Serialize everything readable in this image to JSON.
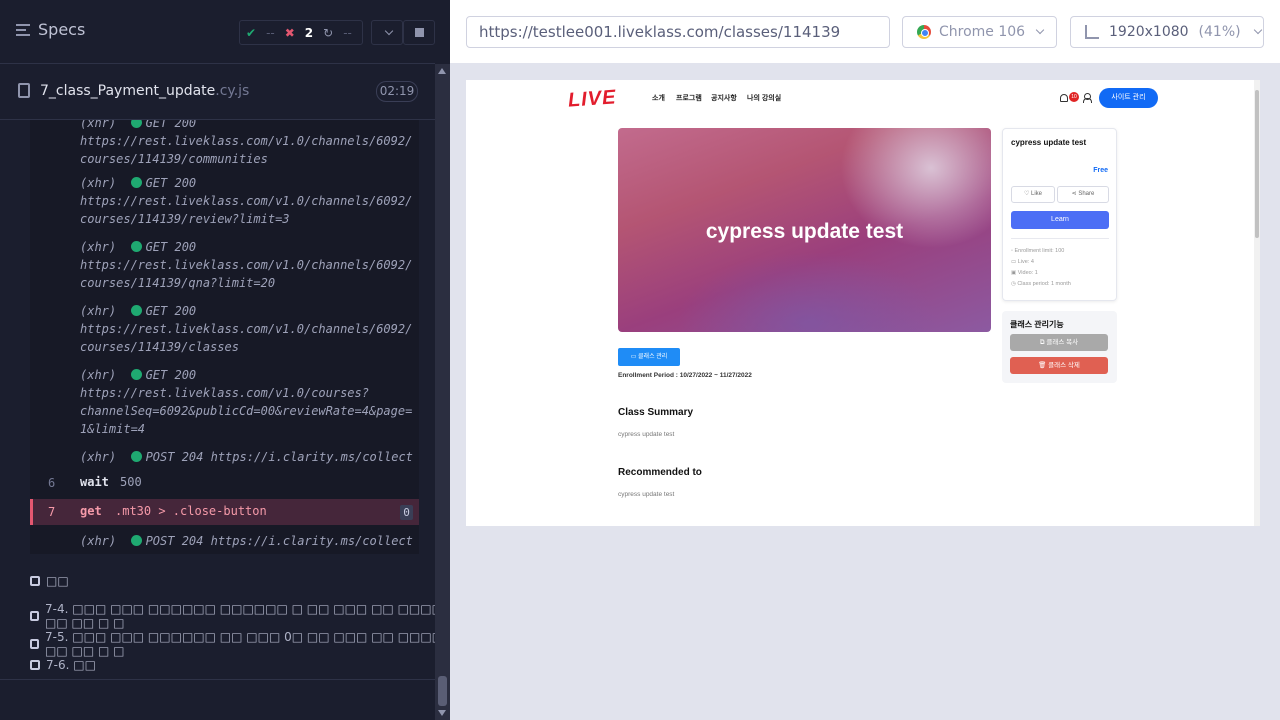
{
  "reporter": {
    "title": "Specs",
    "stats": {
      "passed": "--",
      "failed": "2",
      "pending": "--"
    },
    "spec_file": {
      "name": "7_class_Payment_update",
      "ext": ".cy.js",
      "duration": "02:19"
    },
    "log": [
      {
        "prefix": "(xhr)",
        "method": "GET 200",
        "lines": [
          "https://rest.liveklass.com/v1.0/channels/6092/",
          "courses/114139/communities"
        ]
      },
      {
        "prefix": "(xhr)",
        "method": "GET 200",
        "lines": [
          "https://rest.liveklass.com/v1.0/channels/6092/",
          "courses/114139/review?limit=3"
        ]
      },
      {
        "prefix": "(xhr)",
        "method": "GET 200",
        "lines": [
          "https://rest.liveklass.com/v1.0/channels/6092/",
          "courses/114139/qna?limit=20"
        ]
      },
      {
        "prefix": "(xhr)",
        "method": "GET 200",
        "lines": [
          "https://rest.liveklass.com/v1.0/channels/6092/",
          "courses/114139/classes"
        ]
      },
      {
        "prefix": "(xhr)",
        "method": "GET 200",
        "lines": [
          "https://rest.liveklass.com/v1.0/courses?",
          "channelSeq=6092&publicCd=00&reviewRate=4&page=",
          "1&limit=4"
        ]
      },
      {
        "prefix": "(xhr)",
        "method": "POST 204 https://i.clarity.ms/collect",
        "lines": []
      }
    ],
    "commands": [
      {
        "num": "6",
        "name": "wait",
        "arg": "500"
      },
      {
        "num": "7",
        "name": "get",
        "arg": ".mt30 > .close-button",
        "badge": "0"
      }
    ],
    "last_xhr": {
      "prefix": "(xhr)",
      "method": "POST 204 https://i.clarity.ms/collect"
    },
    "tests": [
      "□□",
      "7-4. □□□ □□□ □□□□□□ □□□□□□ □ □□ □□□ □□ □□□□ □□ □□ □ □",
      "7-5. □□□ □□□ □□□□□□ □□ □□□ 0□ □□ □□□ □□ □□□□ □□ □□ □ □",
      "7-6. □□"
    ]
  },
  "browser": {
    "url": "https://testlee001.liveklass.com/classes/114139",
    "name": "Chrome 106",
    "viewport": "1920x1080",
    "zoom": "(41%)"
  },
  "app": {
    "logo": "LIVE",
    "nav": [
      "소개",
      "프로그램",
      "공지사항",
      "나의 강의실"
    ],
    "notif_count": "10",
    "admin_button": "사이트 관리",
    "hero_title": "cypress update test",
    "card": {
      "title": "cypress update test",
      "price": "Free",
      "like": "♡ Like",
      "share": "Share",
      "learn": "Learn",
      "info": [
        "Enrollment limit: 100",
        "Live: 4",
        "Video: 1",
        "Class period: 1 month"
      ]
    },
    "manage": {
      "title": "클래스 관리기능",
      "copy": "클래스 복사",
      "delete": "클래스 삭제"
    },
    "class_manage_button": "클래스 관리",
    "enrollment_period": "Enrollment Period : 10/27/2022 ~ 11/27/2022",
    "summary_title": "Class Summary",
    "summary_text": "cypress update test",
    "recommended_title": "Recommended to",
    "recommended_text": "cypress update test"
  }
}
